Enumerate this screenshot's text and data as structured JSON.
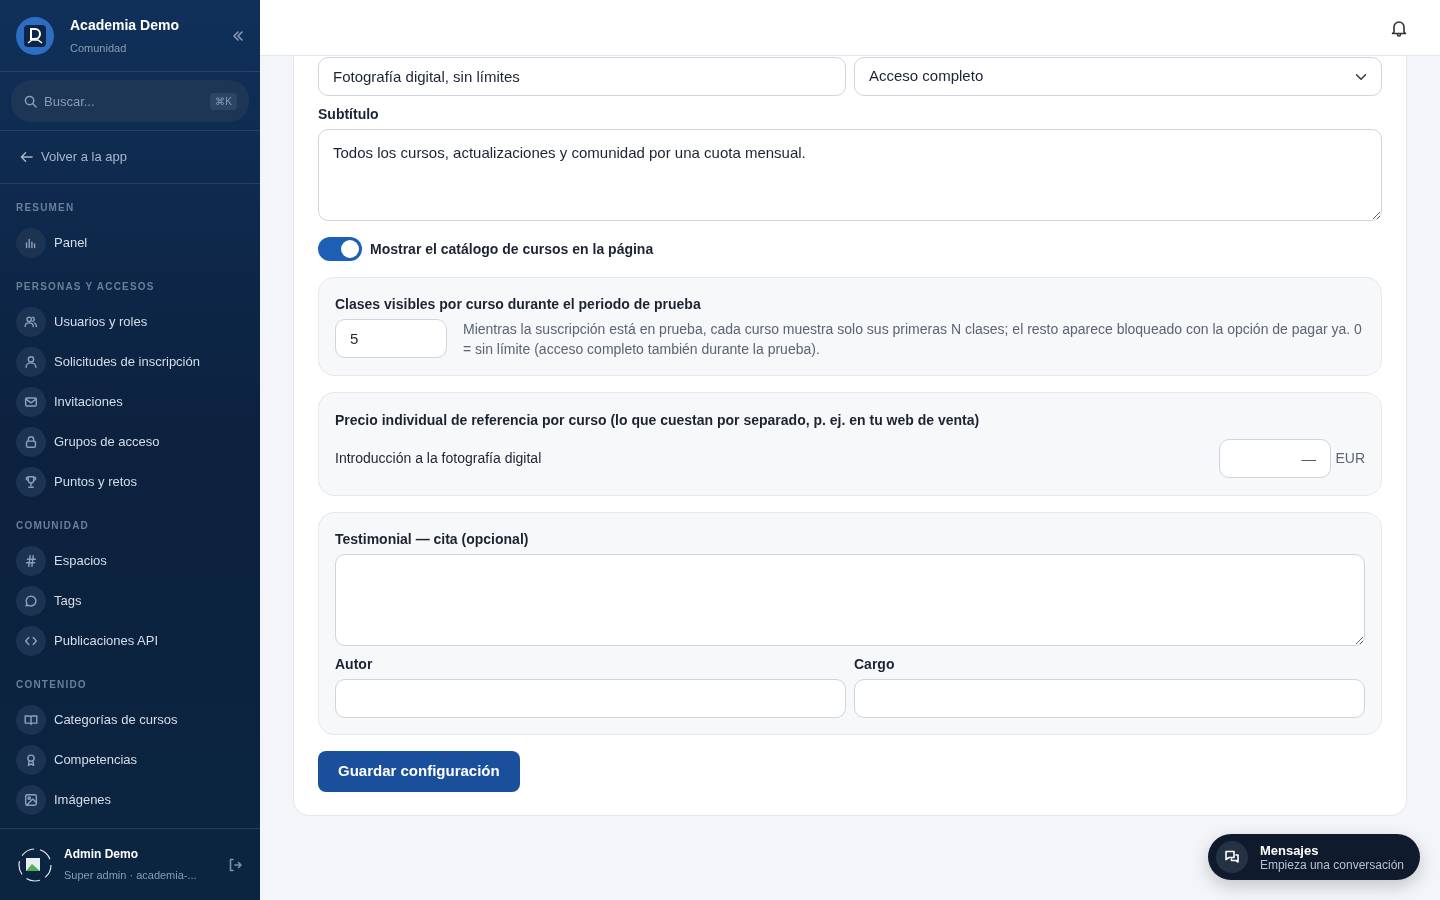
{
  "brand": {
    "title": "Academia Demo",
    "subtitle": "Comunidad"
  },
  "search": {
    "placeholder": "Buscar...",
    "shortcut": "⌘K"
  },
  "back_link": "Volver a la app",
  "sidebar": {
    "sections": [
      {
        "title": "RESUMEN",
        "items": [
          {
            "label": "Panel",
            "selected": false
          }
        ]
      },
      {
        "title": "PERSONAS Y ACCESOS",
        "items": [
          {
            "label": "Usuarios y roles",
            "selected": false
          },
          {
            "label": "Solicitudes de inscripción",
            "selected": false
          },
          {
            "label": "Invitaciones",
            "selected": false
          },
          {
            "label": "Grupos de acceso",
            "selected": false
          },
          {
            "label": "Puntos y retos",
            "selected": false
          }
        ]
      },
      {
        "title": "COMUNIDAD",
        "items": [
          {
            "label": "Espacios",
            "selected": false
          },
          {
            "label": "Tags",
            "selected": false
          },
          {
            "label": "Publicaciones API",
            "selected": false
          }
        ]
      },
      {
        "title": "CONTENIDO",
        "items": [
          {
            "label": "Categorías de cursos",
            "selected": false
          },
          {
            "label": "Competencias",
            "selected": false
          },
          {
            "label": "Imágenes",
            "selected": false
          }
        ]
      }
    ]
  },
  "user": {
    "name": "Admin Demo",
    "role": "Super admin · academia-..."
  },
  "form": {
    "title_value": "Fotografía digital, sin límites",
    "access_value": "Acceso completo",
    "subtitle_label": "Subtítulo",
    "subtitle_value": "Todos los cursos, actualizaciones y comunidad por una cuota mensual.",
    "catalog_toggle": {
      "label": "Mostrar el catálogo de cursos en la página",
      "on": true
    },
    "trial": {
      "label": "Clases visibles por curso durante el periodo de prueba",
      "value": "5",
      "help": "Mientras la suscripción está en prueba, cada curso muestra solo sus primeras N clases; el resto aparece bloqueado con la opción de pagar ya. 0 = sin límite (acceso completo también durante la prueba)."
    },
    "prices": {
      "label": "Precio individual de referencia por curso (lo que cuestan por separado, p. ej. en tu web de venta)",
      "rows": [
        {
          "course": "Introducción a la fotografía digital",
          "placeholder": "—",
          "currency": "EUR"
        }
      ]
    },
    "testimonial": {
      "label": "Testimonial — cita (opcional)",
      "author_label": "Autor",
      "role_label": "Cargo"
    },
    "save_button": "Guardar configuración"
  },
  "messages": {
    "title": "Mensajes",
    "subtitle": "Empieza una conversación"
  }
}
